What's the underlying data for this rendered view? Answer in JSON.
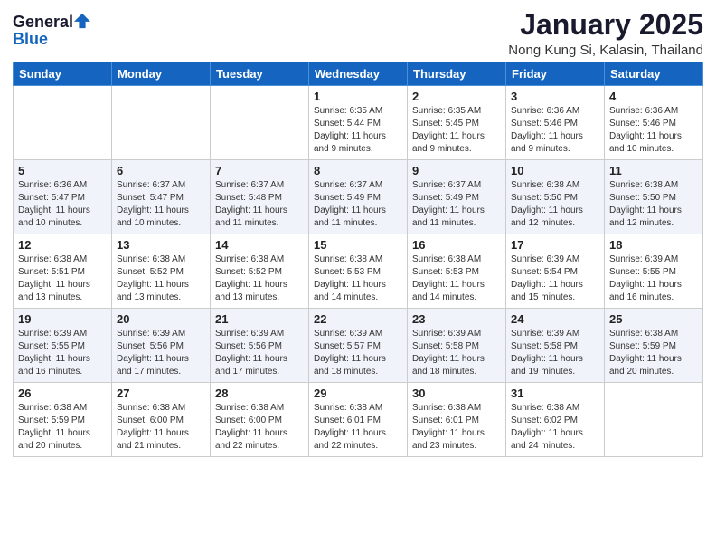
{
  "header": {
    "logo_line1": "General",
    "logo_line2": "Blue",
    "month_title": "January 2025",
    "subtitle": "Nong Kung Si, Kalasin, Thailand"
  },
  "weekdays": [
    "Sunday",
    "Monday",
    "Tuesday",
    "Wednesday",
    "Thursday",
    "Friday",
    "Saturday"
  ],
  "weeks": [
    [
      {
        "day": "",
        "info": ""
      },
      {
        "day": "",
        "info": ""
      },
      {
        "day": "",
        "info": ""
      },
      {
        "day": "1",
        "info": "Sunrise: 6:35 AM\nSunset: 5:44 PM\nDaylight: 11 hours\nand 9 minutes."
      },
      {
        "day": "2",
        "info": "Sunrise: 6:35 AM\nSunset: 5:45 PM\nDaylight: 11 hours\nand 9 minutes."
      },
      {
        "day": "3",
        "info": "Sunrise: 6:36 AM\nSunset: 5:46 PM\nDaylight: 11 hours\nand 9 minutes."
      },
      {
        "day": "4",
        "info": "Sunrise: 6:36 AM\nSunset: 5:46 PM\nDaylight: 11 hours\nand 10 minutes."
      }
    ],
    [
      {
        "day": "5",
        "info": "Sunrise: 6:36 AM\nSunset: 5:47 PM\nDaylight: 11 hours\nand 10 minutes."
      },
      {
        "day": "6",
        "info": "Sunrise: 6:37 AM\nSunset: 5:47 PM\nDaylight: 11 hours\nand 10 minutes."
      },
      {
        "day": "7",
        "info": "Sunrise: 6:37 AM\nSunset: 5:48 PM\nDaylight: 11 hours\nand 11 minutes."
      },
      {
        "day": "8",
        "info": "Sunrise: 6:37 AM\nSunset: 5:49 PM\nDaylight: 11 hours\nand 11 minutes."
      },
      {
        "day": "9",
        "info": "Sunrise: 6:37 AM\nSunset: 5:49 PM\nDaylight: 11 hours\nand 11 minutes."
      },
      {
        "day": "10",
        "info": "Sunrise: 6:38 AM\nSunset: 5:50 PM\nDaylight: 11 hours\nand 12 minutes."
      },
      {
        "day": "11",
        "info": "Sunrise: 6:38 AM\nSunset: 5:50 PM\nDaylight: 11 hours\nand 12 minutes."
      }
    ],
    [
      {
        "day": "12",
        "info": "Sunrise: 6:38 AM\nSunset: 5:51 PM\nDaylight: 11 hours\nand 13 minutes."
      },
      {
        "day": "13",
        "info": "Sunrise: 6:38 AM\nSunset: 5:52 PM\nDaylight: 11 hours\nand 13 minutes."
      },
      {
        "day": "14",
        "info": "Sunrise: 6:38 AM\nSunset: 5:52 PM\nDaylight: 11 hours\nand 13 minutes."
      },
      {
        "day": "15",
        "info": "Sunrise: 6:38 AM\nSunset: 5:53 PM\nDaylight: 11 hours\nand 14 minutes."
      },
      {
        "day": "16",
        "info": "Sunrise: 6:38 AM\nSunset: 5:53 PM\nDaylight: 11 hours\nand 14 minutes."
      },
      {
        "day": "17",
        "info": "Sunrise: 6:39 AM\nSunset: 5:54 PM\nDaylight: 11 hours\nand 15 minutes."
      },
      {
        "day": "18",
        "info": "Sunrise: 6:39 AM\nSunset: 5:55 PM\nDaylight: 11 hours\nand 16 minutes."
      }
    ],
    [
      {
        "day": "19",
        "info": "Sunrise: 6:39 AM\nSunset: 5:55 PM\nDaylight: 11 hours\nand 16 minutes."
      },
      {
        "day": "20",
        "info": "Sunrise: 6:39 AM\nSunset: 5:56 PM\nDaylight: 11 hours\nand 17 minutes."
      },
      {
        "day": "21",
        "info": "Sunrise: 6:39 AM\nSunset: 5:56 PM\nDaylight: 11 hours\nand 17 minutes."
      },
      {
        "day": "22",
        "info": "Sunrise: 6:39 AM\nSunset: 5:57 PM\nDaylight: 11 hours\nand 18 minutes."
      },
      {
        "day": "23",
        "info": "Sunrise: 6:39 AM\nSunset: 5:58 PM\nDaylight: 11 hours\nand 18 minutes."
      },
      {
        "day": "24",
        "info": "Sunrise: 6:39 AM\nSunset: 5:58 PM\nDaylight: 11 hours\nand 19 minutes."
      },
      {
        "day": "25",
        "info": "Sunrise: 6:38 AM\nSunset: 5:59 PM\nDaylight: 11 hours\nand 20 minutes."
      }
    ],
    [
      {
        "day": "26",
        "info": "Sunrise: 6:38 AM\nSunset: 5:59 PM\nDaylight: 11 hours\nand 20 minutes."
      },
      {
        "day": "27",
        "info": "Sunrise: 6:38 AM\nSunset: 6:00 PM\nDaylight: 11 hours\nand 21 minutes."
      },
      {
        "day": "28",
        "info": "Sunrise: 6:38 AM\nSunset: 6:00 PM\nDaylight: 11 hours\nand 22 minutes."
      },
      {
        "day": "29",
        "info": "Sunrise: 6:38 AM\nSunset: 6:01 PM\nDaylight: 11 hours\nand 22 minutes."
      },
      {
        "day": "30",
        "info": "Sunrise: 6:38 AM\nSunset: 6:01 PM\nDaylight: 11 hours\nand 23 minutes."
      },
      {
        "day": "31",
        "info": "Sunrise: 6:38 AM\nSunset: 6:02 PM\nDaylight: 11 hours\nand 24 minutes."
      },
      {
        "day": "",
        "info": ""
      }
    ]
  ]
}
